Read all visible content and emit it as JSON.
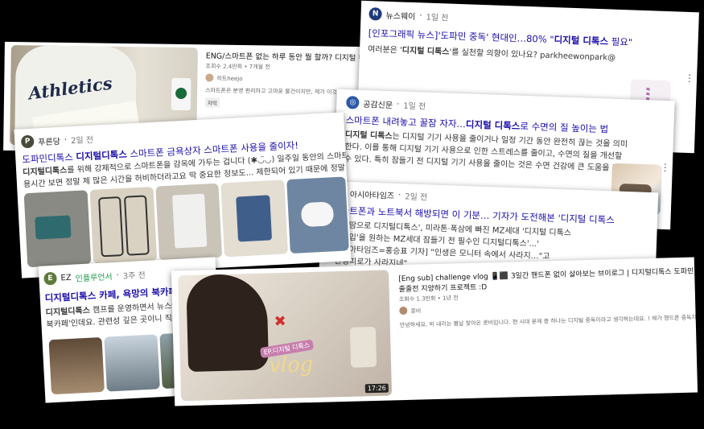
{
  "cards": {
    "youtube_eng": {
      "title": "ENG/스마트폰 없는 하루 동안 뭘 할까? 디지털 디톡스",
      "meta": "조회수 2.4만회 • 7개월 전",
      "channel": "히트heejo",
      "desc": "스마트폰은 분명 편리하고 고마운 물건이지만, 제가 이것을 신체의 일부라도 되는",
      "chip": "자막",
      "shirt_text": "Athletics"
    },
    "newsway": {
      "source": "뉴스웨이",
      "ago": "1일 전",
      "logo_letter": "N",
      "title_pre": "[인포그래픽 뉴스]'도파민 중독' 현대인…80% \"",
      "title_bold": "디지털 디톡스",
      "title_post": " 필요\"",
      "snippet_pre": "여러분은 '",
      "snippet_bold": "디지털 디톡스",
      "snippet_post": "'를 실천할 의향이 있나요? parkheewonpark@"
    },
    "gonggam": {
      "source": "공감신문",
      "ago": "1일 전",
      "title_pre": "스마트폰 내려놓고 꿀잠 자자…",
      "title_bold": "디지털 디톡스",
      "title_post": "로 수면의 질 높이는 법",
      "snippet1_bold": "디지털 디톡스",
      "snippet1_rest": "는 디지털 기기 사용을 줄이거나 일정 기간 동안 완전히 끊는 것을 의미",
      "snippet2": "한다. 이를 통해 디지털 기기 사용으로 인한 스트레스를 줄이고, 수면의 질을 개선할",
      "snippet3": "수 있다. 특히 잠들기 전 디지털 기기 사용을 줄이는 것은 수면 건강에 큰 도움을 준..."
    },
    "asiatimes": {
      "source": "아시아타임즈",
      "ago": "2일 전",
      "title": "스마트폰과 노트북서 해방되면 이 기분… 기자가 도전해본 '디지털 디톡스",
      "snippet1": "'구슬땀으로 디지털디톡스', 미라톤·폭삼에 빠진 MZ세대 '디지털 디톡스",
      "snippet2": "독·홈입'을 원하는 MZ세대 잠들기 전 필수인 디지털디톡스'...'",
      "snippet3": "[아시아타임즈=홍승표 기자] \"인생은 모니터 속에서 사라지…\"고",
      "snippet4": "\"만성피로가 사라지네\""
    },
    "pumundang": {
      "source": "푸른당",
      "ago": "2일 전",
      "title_pre": "도파민디톡스 ",
      "title_bold": "디지털디톡스",
      "title_post": " 스마트폰 금욕상자 스마트폰 사용을 줄이자!",
      "snippet1_pre": "일주일 동안의 스마트폰",
      "snippet1_tail": "위해 정말 필",
      "snippet2_bold": "디지털디톡스",
      "snippet2_rest": "를 위해 강제적으로 스마트폰을 감옥에 가두는 겁니다 (✱◡̈◡)",
      "snippet3": "용시간 보면 정말 제 많은 시간을 허비하더라고요 딱 중요한 정보도... 제한되어 있기 때문에 정말"
    },
    "ez": {
      "source": "EZ",
      "source_tag": "인플루언서",
      "ago": "3주 전",
      "title": "디지털디톡스 카페, 욕망의 북카페 방",
      "snippet1_bold": "디지털디톡스",
      "snippet1_rest": " 캠프를 운영하면서 뉴스에",
      "snippet2": "북카페'인데요. 관련성 깊은 곳이니 직접"
    },
    "youtube_vlog": {
      "title": "[Eng sub] challenge vlog 📱⬛ 3일간 핸드폰 없이 살아보는 브이로그 | 디지털디톡스 도파민",
      "title2": "줄줄전 지양하기 프로젝트 :D",
      "meta": "조회수 1.3만회 • 1년 전",
      "channel": "콩비",
      "desc": "안녕하세요, 비 내리는 봄날 찾아온 콩비입니다. 현 시대 문제 중 하나는 디지털 중독이라고 생각하는데요. ! 제가 핸드폰 중독자 중 ...",
      "duration": "17:26",
      "caption_tag": "EP.디지털 디톡스",
      "overlay_text": "vlog"
    }
  },
  "colors": {
    "link": "#1a0dab",
    "bg": "#000000"
  },
  "icons": [
    "kebab-menu-icon",
    "phone-icon",
    "no-phone-icon"
  ]
}
